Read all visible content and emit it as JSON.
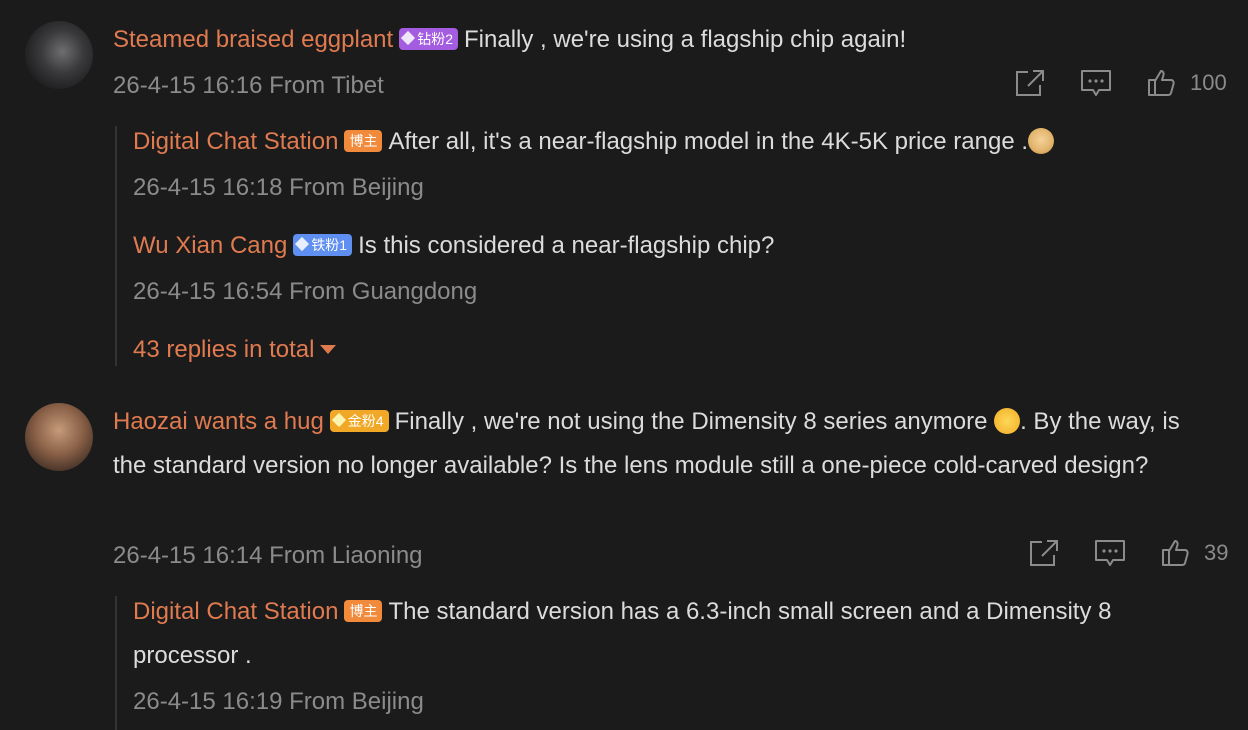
{
  "comments": [
    {
      "author": "Steamed braised eggplant",
      "badge": "钻粉2",
      "text": "Finally , we're using a flagship chip again!",
      "meta": "26-4-15 16:16 From Tibet",
      "likes": "100",
      "replies": [
        {
          "author": "Digital Chat Station",
          "badge": "博主",
          "text": "After all, it's a near-flagship model in the 4K-5K price range .",
          "meta": "26-4-15 16:18 From Beijing"
        },
        {
          "author": "Wu Xian Cang",
          "badge": "铁粉1",
          "text": "Is this considered a near-flagship chip?",
          "meta": "26-4-15 16:54 From Guangdong"
        }
      ],
      "more_replies": "43 replies in total"
    },
    {
      "author": "Haozai wants a hug",
      "badge": "金粉4",
      "text_a": "Finally , we're not using the Dimensity 8 series anymore",
      "text_b": ". By the way, is the standard version no longer available? Is the lens module still a one-piece cold-carved design?",
      "meta": "26-4-15 16:14 From Liaoning",
      "likes": "39",
      "replies": [
        {
          "author": "Digital Chat Station",
          "badge": "博主",
          "text": "The standard version has a 6.3-inch small screen and a Dimensity 8 processor .",
          "meta": "26-4-15 16:19 From Beijing"
        }
      ]
    }
  ],
  "icons": {
    "share": "share-icon",
    "comment": "comment-icon",
    "like": "thumbs-up-icon"
  },
  "colors": {
    "background": "#1b1b1c",
    "name": "#e07a4f",
    "meta": "#8b8b8b",
    "badge_diamond": "#a45de0",
    "badge_iron": "#5f8ff0",
    "badge_gold": "#f1a827",
    "badge_blogger": "#f28a3b"
  }
}
